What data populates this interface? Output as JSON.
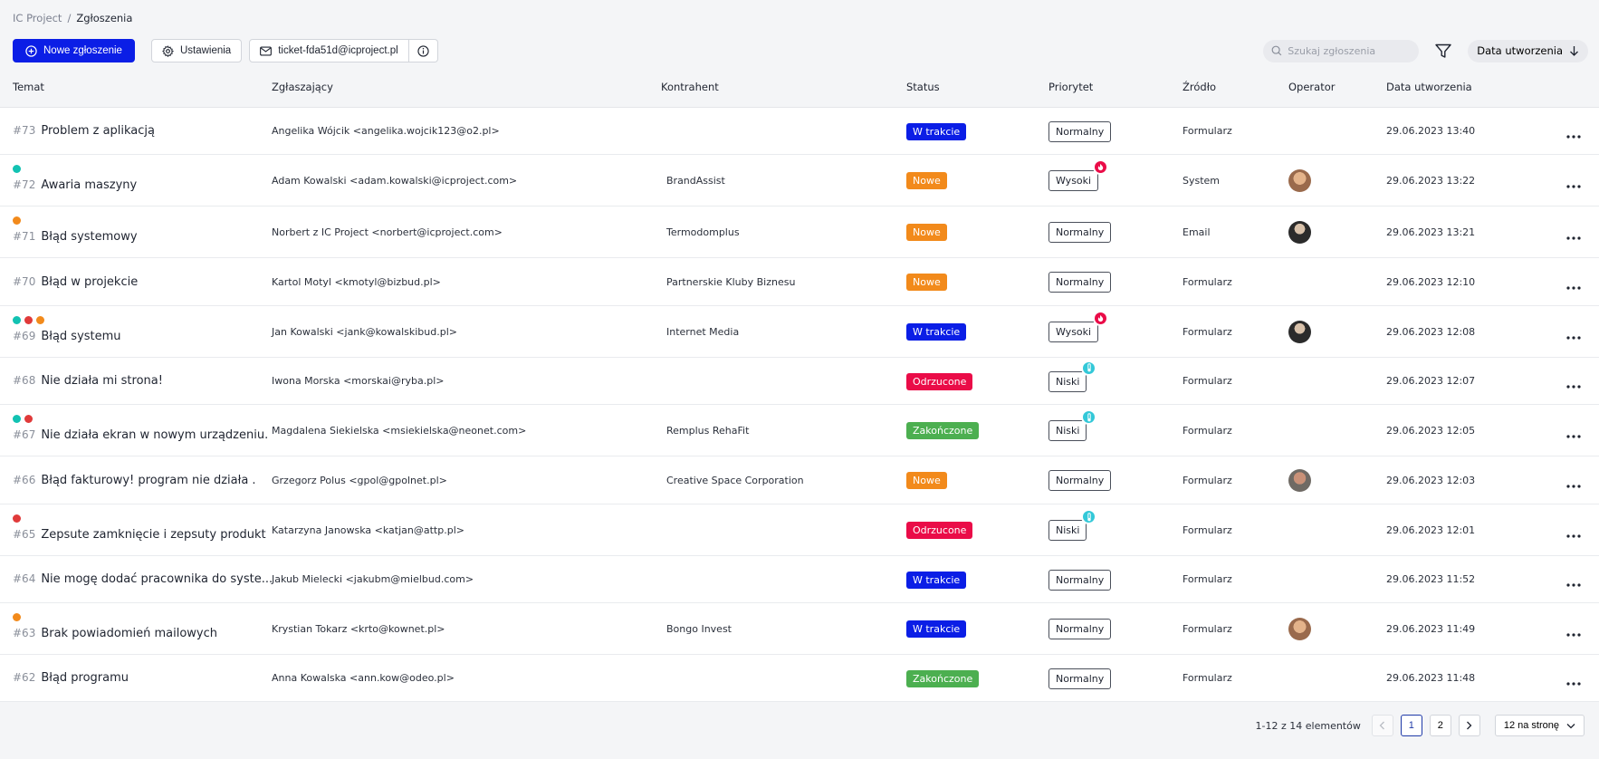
{
  "breadcrumb": {
    "root": "IC Project",
    "separator": "/",
    "current": "Zgłoszenia"
  },
  "toolbar": {
    "new_ticket": "Nowe zgłoszenie",
    "settings": "Ustawienia",
    "email": "ticket-fda51d@icproject.pl"
  },
  "search": {
    "placeholder": "Szukaj zgłoszenia",
    "value": ""
  },
  "sort": {
    "label": "Data utworzenia",
    "direction": "desc"
  },
  "columns": {
    "subject": "Temat",
    "reporter": "Zgłaszający",
    "contractor": "Kontrahent",
    "status": "Status",
    "priority": "Priorytet",
    "source": "Źródło",
    "operator": "Operator",
    "created": "Data utworzenia"
  },
  "colors": {
    "primary": "#0b1ee6",
    "status_in_progress": "#0b1ee6",
    "status_new": "#f28a1b",
    "status_rejected": "#ea0c48",
    "status_done": "#4caf50",
    "dot_teal": "#12c2b2",
    "dot_orange": "#f28a1b",
    "dot_red": "#e03a3a",
    "prio_high_badge": "#ea0c48",
    "prio_low_badge": "#33c8d8"
  },
  "tickets": [
    {
      "number": "#73",
      "title": "Problem z aplikacją",
      "dots": [],
      "reporter": "Angelika Wójcik <angelika.wojcik123@o2.pl>",
      "contractor": "",
      "status": "W trakcie",
      "status_kind": "in_progress",
      "priority": "Normalny",
      "priority_badge": "",
      "source": "Formularz",
      "operator": "",
      "created": "29.06.2023 13:40"
    },
    {
      "number": "#72",
      "title": "Awaria maszyny",
      "dots": [
        "teal"
      ],
      "reporter": "Adam Kowalski <adam.kowalski@icproject.com>",
      "contractor": "BrandAssist",
      "status": "Nowe",
      "status_kind": "new",
      "priority": "Wysoki",
      "priority_badge": "fire-icon",
      "source": "System",
      "operator": "avatar-1",
      "created": "29.06.2023 13:22"
    },
    {
      "number": "#71",
      "title": "Błąd systemowy",
      "dots": [
        "orange"
      ],
      "reporter": "Norbert z IC Project <norbert@icproject.com>",
      "contractor": "Termodomplus",
      "status": "Nowe",
      "status_kind": "new",
      "priority": "Normalny",
      "priority_badge": "",
      "source": "Email",
      "operator": "avatar-2",
      "created": "29.06.2023 13:21"
    },
    {
      "number": "#70",
      "title": "Błąd w projekcie",
      "dots": [],
      "reporter": "Kartol Motyl <kmotyl@bizbud.pl>",
      "contractor": "Partnerskie Kluby Biznesu",
      "status": "Nowe",
      "status_kind": "new",
      "priority": "Normalny",
      "priority_badge": "",
      "source": "Formularz",
      "operator": "",
      "created": "29.06.2023 12:10"
    },
    {
      "number": "#69",
      "title": "Błąd systemu",
      "dots": [
        "teal",
        "red",
        "orange"
      ],
      "reporter": "Jan Kowalski <jank@kowalskibud.pl>",
      "contractor": "Internet Media",
      "status": "W trakcie",
      "status_kind": "in_progress",
      "priority": "Wysoki",
      "priority_badge": "fire-icon",
      "source": "Formularz",
      "operator": "avatar-2",
      "created": "29.06.2023 12:08"
    },
    {
      "number": "#68",
      "title": "Nie działa mi strona!",
      "dots": [],
      "reporter": "Iwona Morska <morskai@ryba.pl>",
      "contractor": "",
      "status": "Odrzucone",
      "status_kind": "rejected",
      "priority": "Niski",
      "priority_badge": "thermometer-icon",
      "source": "Formularz",
      "operator": "",
      "created": "29.06.2023 12:07"
    },
    {
      "number": "#67",
      "title": "Nie działa ekran w nowym urządzeniu.",
      "dots": [
        "teal",
        "red"
      ],
      "reporter": "Magdalena Siekielska <msiekielska@neonet.com>",
      "contractor": "Remplus RehaFit",
      "status": "Zakończone",
      "status_kind": "done",
      "priority": "Niski",
      "priority_badge": "thermometer-icon",
      "source": "Formularz",
      "operator": "",
      "created": "29.06.2023 12:05"
    },
    {
      "number": "#66",
      "title": "Błąd fakturowy! program nie działa .",
      "dots": [],
      "reporter": "Grzegorz Polus <gpol@gpolnet.pl>",
      "contractor": "Creative Space Corporation",
      "status": "Nowe",
      "status_kind": "new",
      "priority": "Normalny",
      "priority_badge": "",
      "source": "Formularz",
      "operator": "avatar-3",
      "created": "29.06.2023 12:03"
    },
    {
      "number": "#65",
      "title": "Zepsute zamknięcie i zepsuty produkt",
      "dots": [
        "red"
      ],
      "reporter": "Katarzyna Janowska <katjan@attp.pl>",
      "contractor": "",
      "status": "Odrzucone",
      "status_kind": "rejected",
      "priority": "Niski",
      "priority_badge": "thermometer-icon",
      "source": "Formularz",
      "operator": "",
      "created": "29.06.2023 12:01"
    },
    {
      "number": "#64",
      "title": "Nie mogę dodać pracownika do syste...",
      "dots": [],
      "reporter": "Jakub Mielecki <jakubm@mielbud.com>",
      "contractor": "",
      "status": "W trakcie",
      "status_kind": "in_progress",
      "priority": "Normalny",
      "priority_badge": "",
      "source": "Formularz",
      "operator": "",
      "created": "29.06.2023 11:52"
    },
    {
      "number": "#63",
      "title": "Brak powiadomień mailowych",
      "dots": [
        "orange"
      ],
      "reporter": "Krystian Tokarz <krto@kownet.pl>",
      "contractor": "Bongo Invest",
      "status": "W trakcie",
      "status_kind": "in_progress",
      "priority": "Normalny",
      "priority_badge": "",
      "source": "Formularz",
      "operator": "avatar-1",
      "created": "29.06.2023 11:49"
    },
    {
      "number": "#62",
      "title": "Błąd programu",
      "dots": [],
      "reporter": "Anna Kowalska <ann.kow@odeo.pl>",
      "contractor": "",
      "status": "Zakończone",
      "status_kind": "done",
      "priority": "Normalny",
      "priority_badge": "",
      "source": "Formularz",
      "operator": "",
      "created": "29.06.2023 11:48"
    }
  ],
  "pagination": {
    "info": "1-12 z 14 elementów",
    "pages": [
      "1",
      "2"
    ],
    "current": "1",
    "per_page": "12 na stronę"
  }
}
